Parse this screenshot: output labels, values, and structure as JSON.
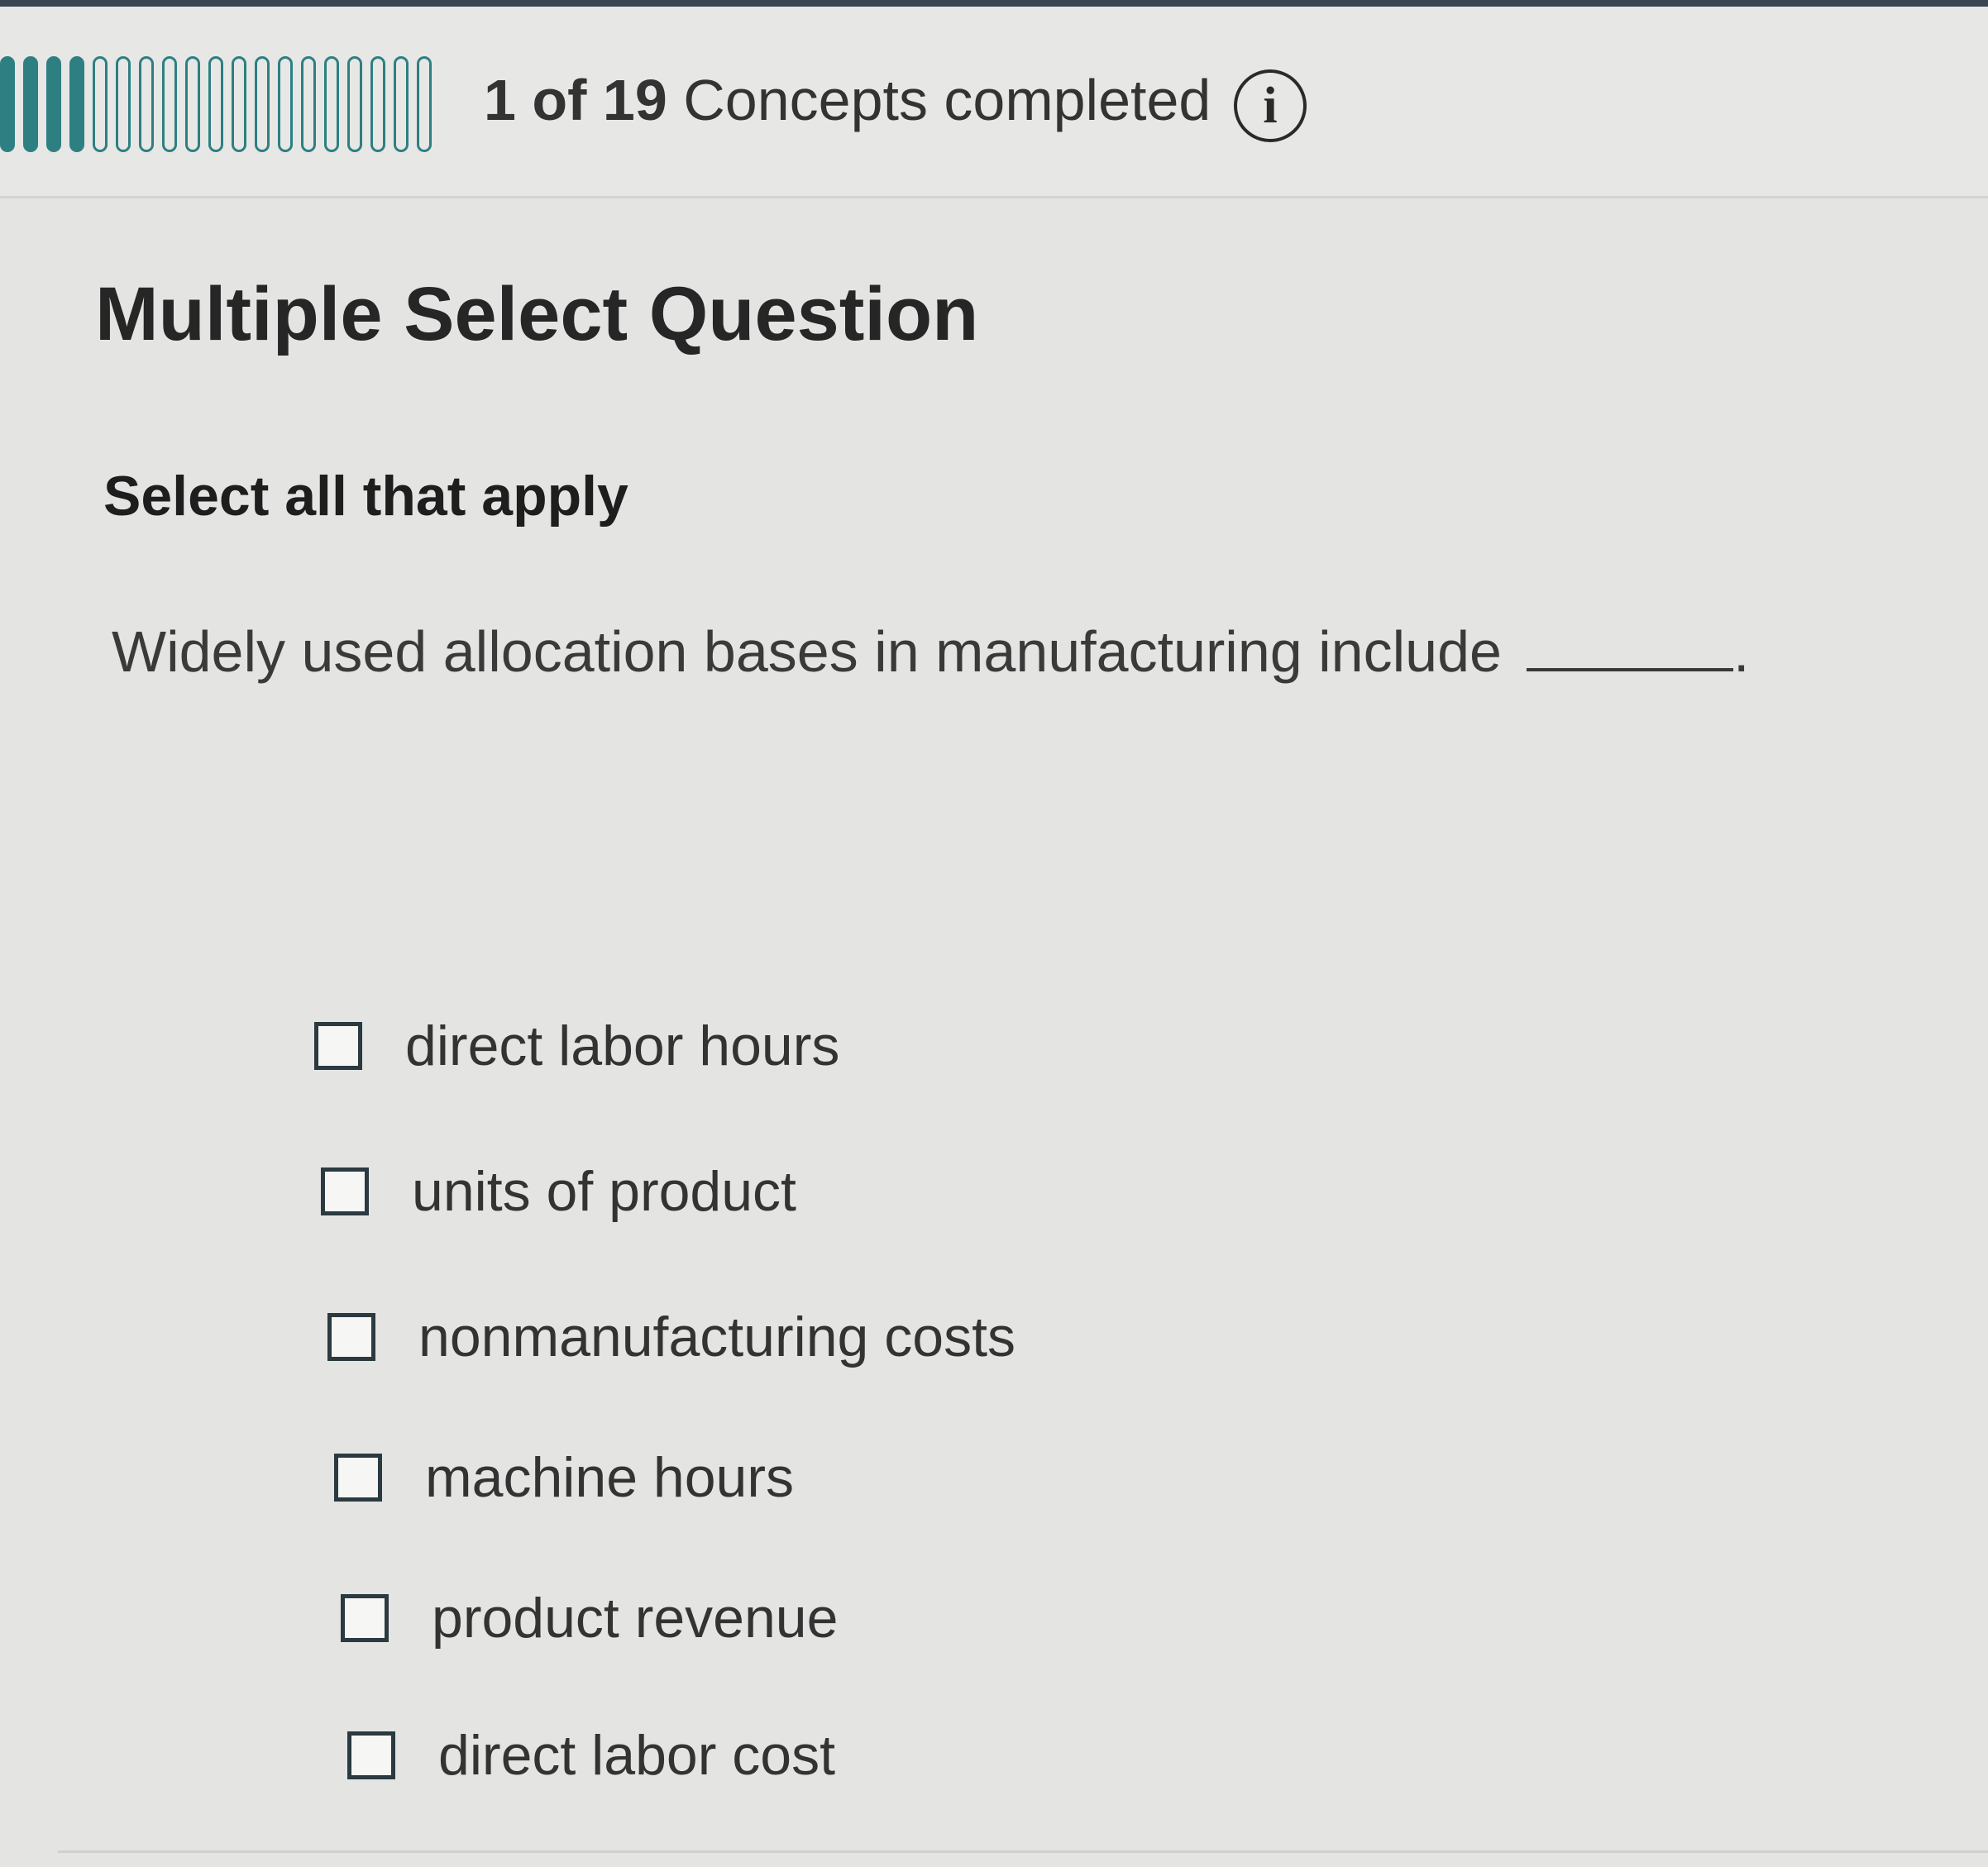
{
  "progress": {
    "completed": 1,
    "total": 19,
    "count_text": "1 of 19",
    "label": "Concepts completed",
    "accent_color": "#2d7f82"
  },
  "info_icon": "i",
  "question": {
    "type_label": "Multiple Select Question",
    "instruction": "Select all that apply",
    "prompt": "Widely used allocation bases in manufacturing include",
    "prompt_end": "."
  },
  "options": [
    {
      "label": "direct labor hours",
      "checked": false
    },
    {
      "label": "units of product",
      "checked": false
    },
    {
      "label": "nonmanufacturing costs",
      "checked": false
    },
    {
      "label": "machine hours",
      "checked": false
    },
    {
      "label": "product revenue",
      "checked": false
    },
    {
      "label": "direct labor cost",
      "checked": false
    }
  ]
}
